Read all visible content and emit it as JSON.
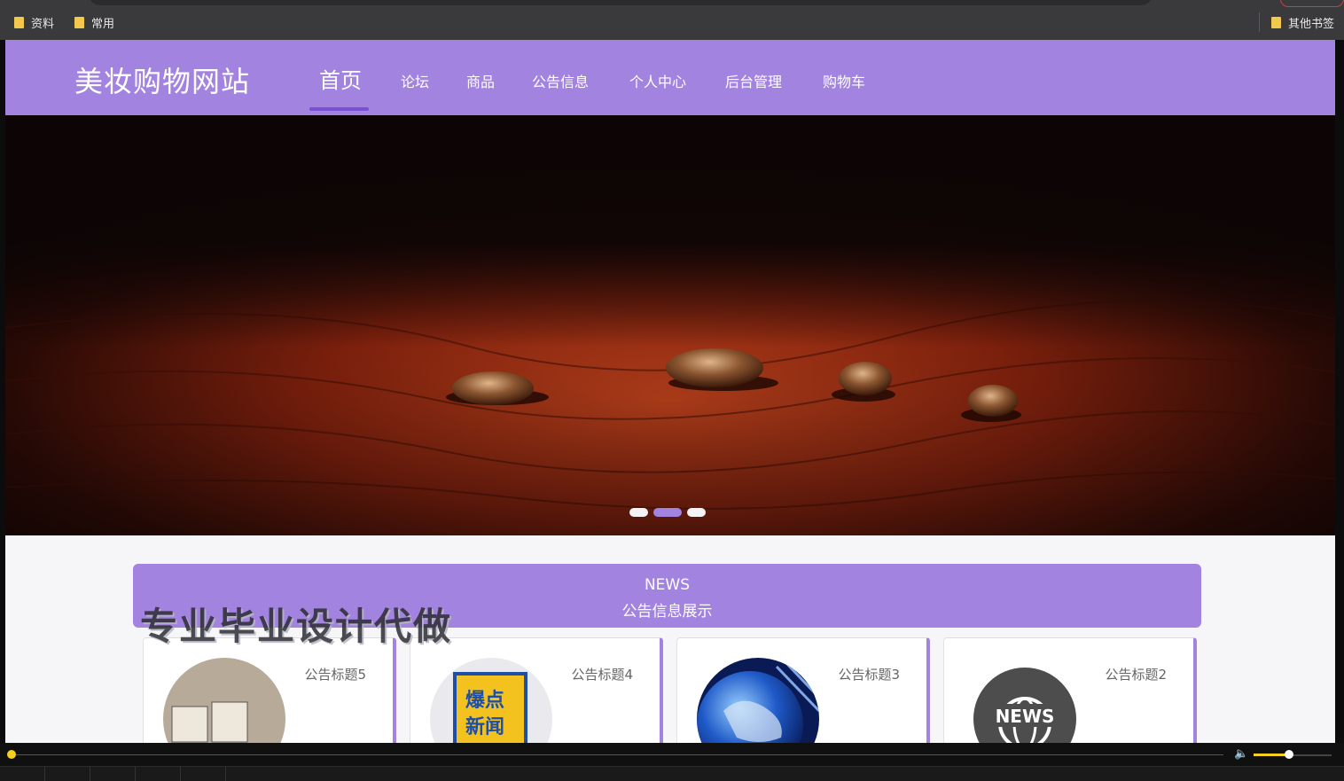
{
  "bookmarks": {
    "items": [
      {
        "label": "资料"
      },
      {
        "label": "常用"
      }
    ],
    "other_label": "其他书签"
  },
  "site": {
    "logo": "美妆购物网站",
    "nav": [
      {
        "label": "首页",
        "active": true
      },
      {
        "label": "论坛"
      },
      {
        "label": "商品"
      },
      {
        "label": "公告信息"
      },
      {
        "label": "个人中心"
      },
      {
        "label": "后台管理"
      },
      {
        "label": "购物车"
      }
    ],
    "carousel": {
      "slide_count": 3,
      "active_index": 1
    },
    "news": {
      "heading_en": "NEWS",
      "heading_cn": "公告信息展示",
      "cards": [
        {
          "title": "公告标题5",
          "icon": "ew-blocks-image"
        },
        {
          "title": "公告标题4",
          "icon": "hot-news-badge-image"
        },
        {
          "title": "公告标题3",
          "icon": "globe-image"
        },
        {
          "title": "公告标题2",
          "icon": "news-globe-icon"
        }
      ]
    },
    "watermark": "专业毕业设计代做"
  },
  "player": {
    "progress": 0.0,
    "volume": 0.45
  },
  "colors": {
    "brand": "#a283e0",
    "accent": "#f5d020"
  }
}
